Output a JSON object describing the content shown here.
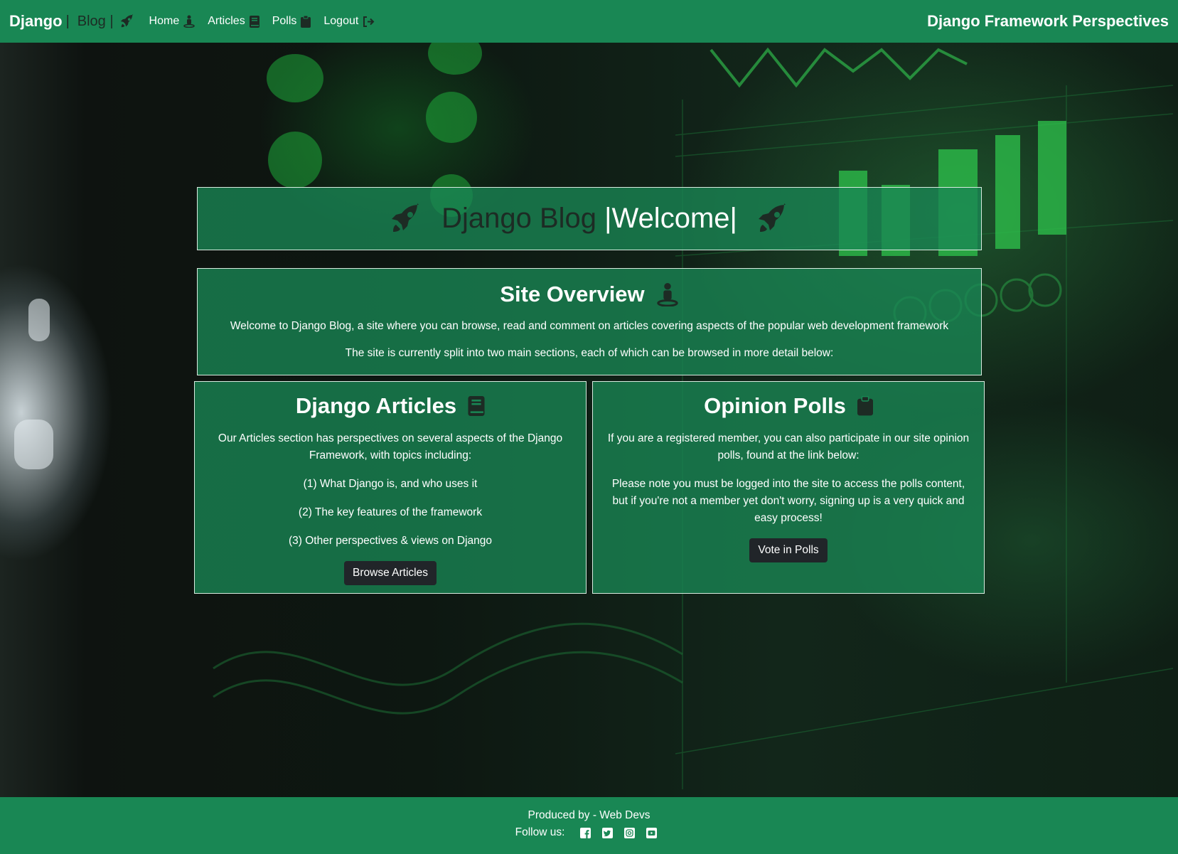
{
  "navbar": {
    "brand_main": "Django",
    "brand_separator": "|",
    "brand_sub": "Blog |",
    "brand_icon": "rocket-icon",
    "links": [
      {
        "label": "Home",
        "icon": "street-view-icon"
      },
      {
        "label": "Articles",
        "icon": "book-icon"
      },
      {
        "label": "Polls",
        "icon": "clipboard-icon"
      },
      {
        "label": "Logout",
        "icon": "sign-out-icon"
      }
    ],
    "right_title": "Django Framework Perspectives"
  },
  "welcome": {
    "title_dark": "Django Blog ",
    "title_light": "|Welcome|",
    "icon": "rocket-icon"
  },
  "overview": {
    "title": "Site Overview",
    "icon": "street-view-icon",
    "paragraph1": "Welcome to Django Blog, a site where you can browse, read and comment on articles covering aspects of the popular web development framework",
    "paragraph2": "The site is currently split into two main sections, each of which can be browsed in more detail below:"
  },
  "articles_card": {
    "title": "Django Articles",
    "icon": "book-icon",
    "intro": "Our Articles section has perspectives on several aspects of the Django Framework, with topics including:",
    "topics": [
      "(1) What Django is, and who uses it",
      "(2) The key features of the framework",
      "(3) Other perspectives & views on Django"
    ],
    "button_label": "Browse Articles"
  },
  "polls_card": {
    "title": "Opinion Polls",
    "icon": "clipboard-icon",
    "paragraph1": "If you are a registered member, you can also participate in our site opinion polls, found at the link below:",
    "paragraph2": "Please note you must be logged into the site to access the polls content, but if you're not a member yet don't worry, signing up is a very quick and easy process!",
    "button_label": "Vote in Polls"
  },
  "footer": {
    "produced_by": "Produced by - Web Devs",
    "follow_label": "Follow us:",
    "social_icons": [
      "facebook-icon",
      "twitter-icon",
      "instagram-icon",
      "youtube-icon"
    ]
  },
  "colors": {
    "primary_green": "#198754",
    "dark": "#212529",
    "dark_text": "#1d2b24"
  }
}
